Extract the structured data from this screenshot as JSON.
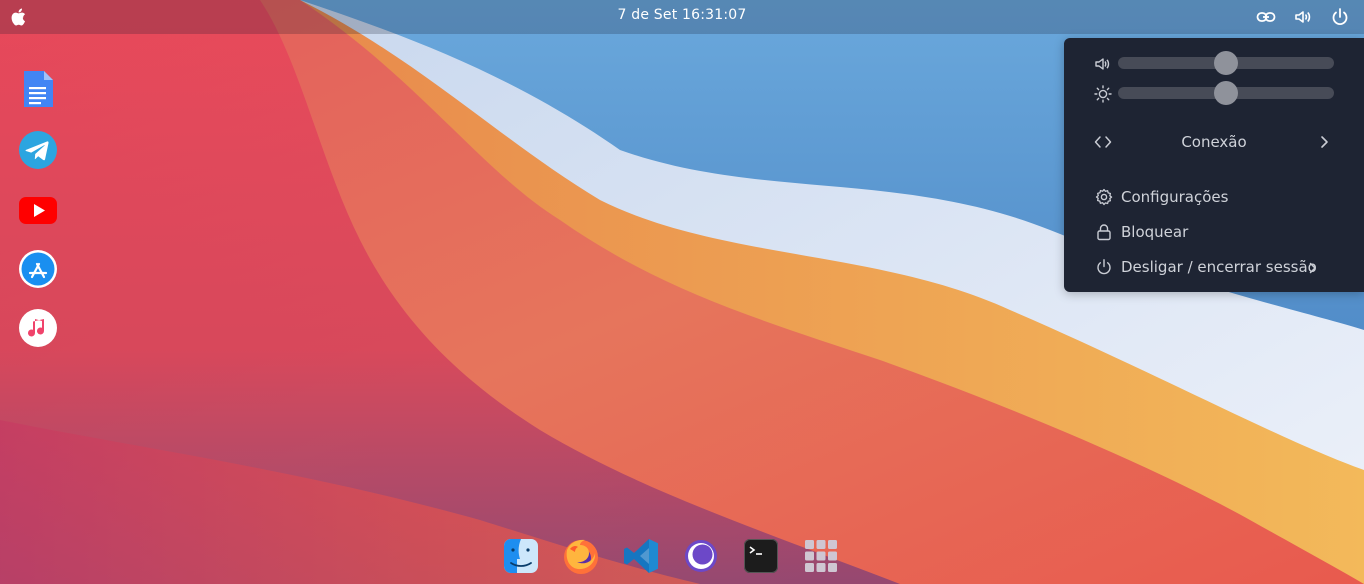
{
  "topbar": {
    "clock": "7 de Set 16:31:07",
    "tray_icons": [
      "link-icon",
      "volume-icon",
      "power-icon"
    ]
  },
  "side_dock": {
    "apps": [
      "google-docs-icon",
      "telegram-icon",
      "youtube-icon",
      "app-store-icon",
      "music-icon"
    ]
  },
  "bottom_dock": {
    "apps": [
      "finder-icon",
      "firefox-icon",
      "vscode-icon",
      "screen-recorder-icon",
      "terminal-icon",
      "app-grid-icon"
    ]
  },
  "quick_settings": {
    "volume_level": 0.5,
    "brightness_level": 0.5,
    "connection_label": "Conexão",
    "items": [
      {
        "label": "Configurações",
        "icon": "gear-icon"
      },
      {
        "label": "Bloquear",
        "icon": "lock-icon"
      },
      {
        "label": "Desligar / encerrar sessão",
        "icon": "power-icon"
      }
    ]
  },
  "colors": {
    "panel_bg": "#1e2433",
    "slider_track": "#474b57",
    "slider_knob": "#8f929b"
  }
}
